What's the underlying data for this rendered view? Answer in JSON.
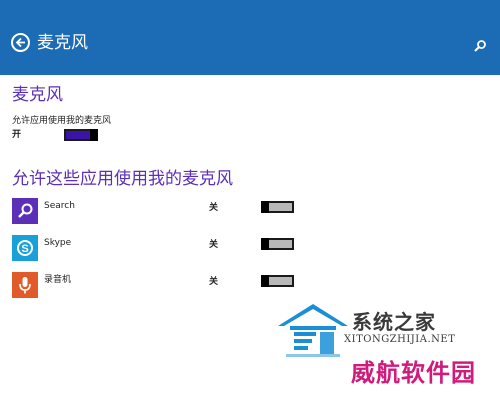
{
  "header": {
    "title": "麦克风"
  },
  "main": {
    "section_title": "麦克风",
    "allow_label": "允许应用使用我的麦克风",
    "allow_state": "开",
    "apps_title": "允许这些应用使用我的麦克风",
    "apps": [
      {
        "name": "Search",
        "state": "关",
        "icon": "search-icon",
        "color": "#5b2fb8"
      },
      {
        "name": "Skype",
        "state": "关",
        "icon": "skype-icon",
        "color": "#1aa0d8"
      },
      {
        "name": "录音机",
        "state": "关",
        "icon": "microphone-icon",
        "color": "#e05a2a"
      }
    ]
  },
  "watermark": {
    "title": "系统之家",
    "url": "XITONGZHIJIA.NET",
    "brand": "威航软件园"
  },
  "colors": {
    "header": "#1b6cb5",
    "accent": "#5b2fb8",
    "toggle_on": "#3a14a6",
    "brand": "#d01a7c"
  }
}
